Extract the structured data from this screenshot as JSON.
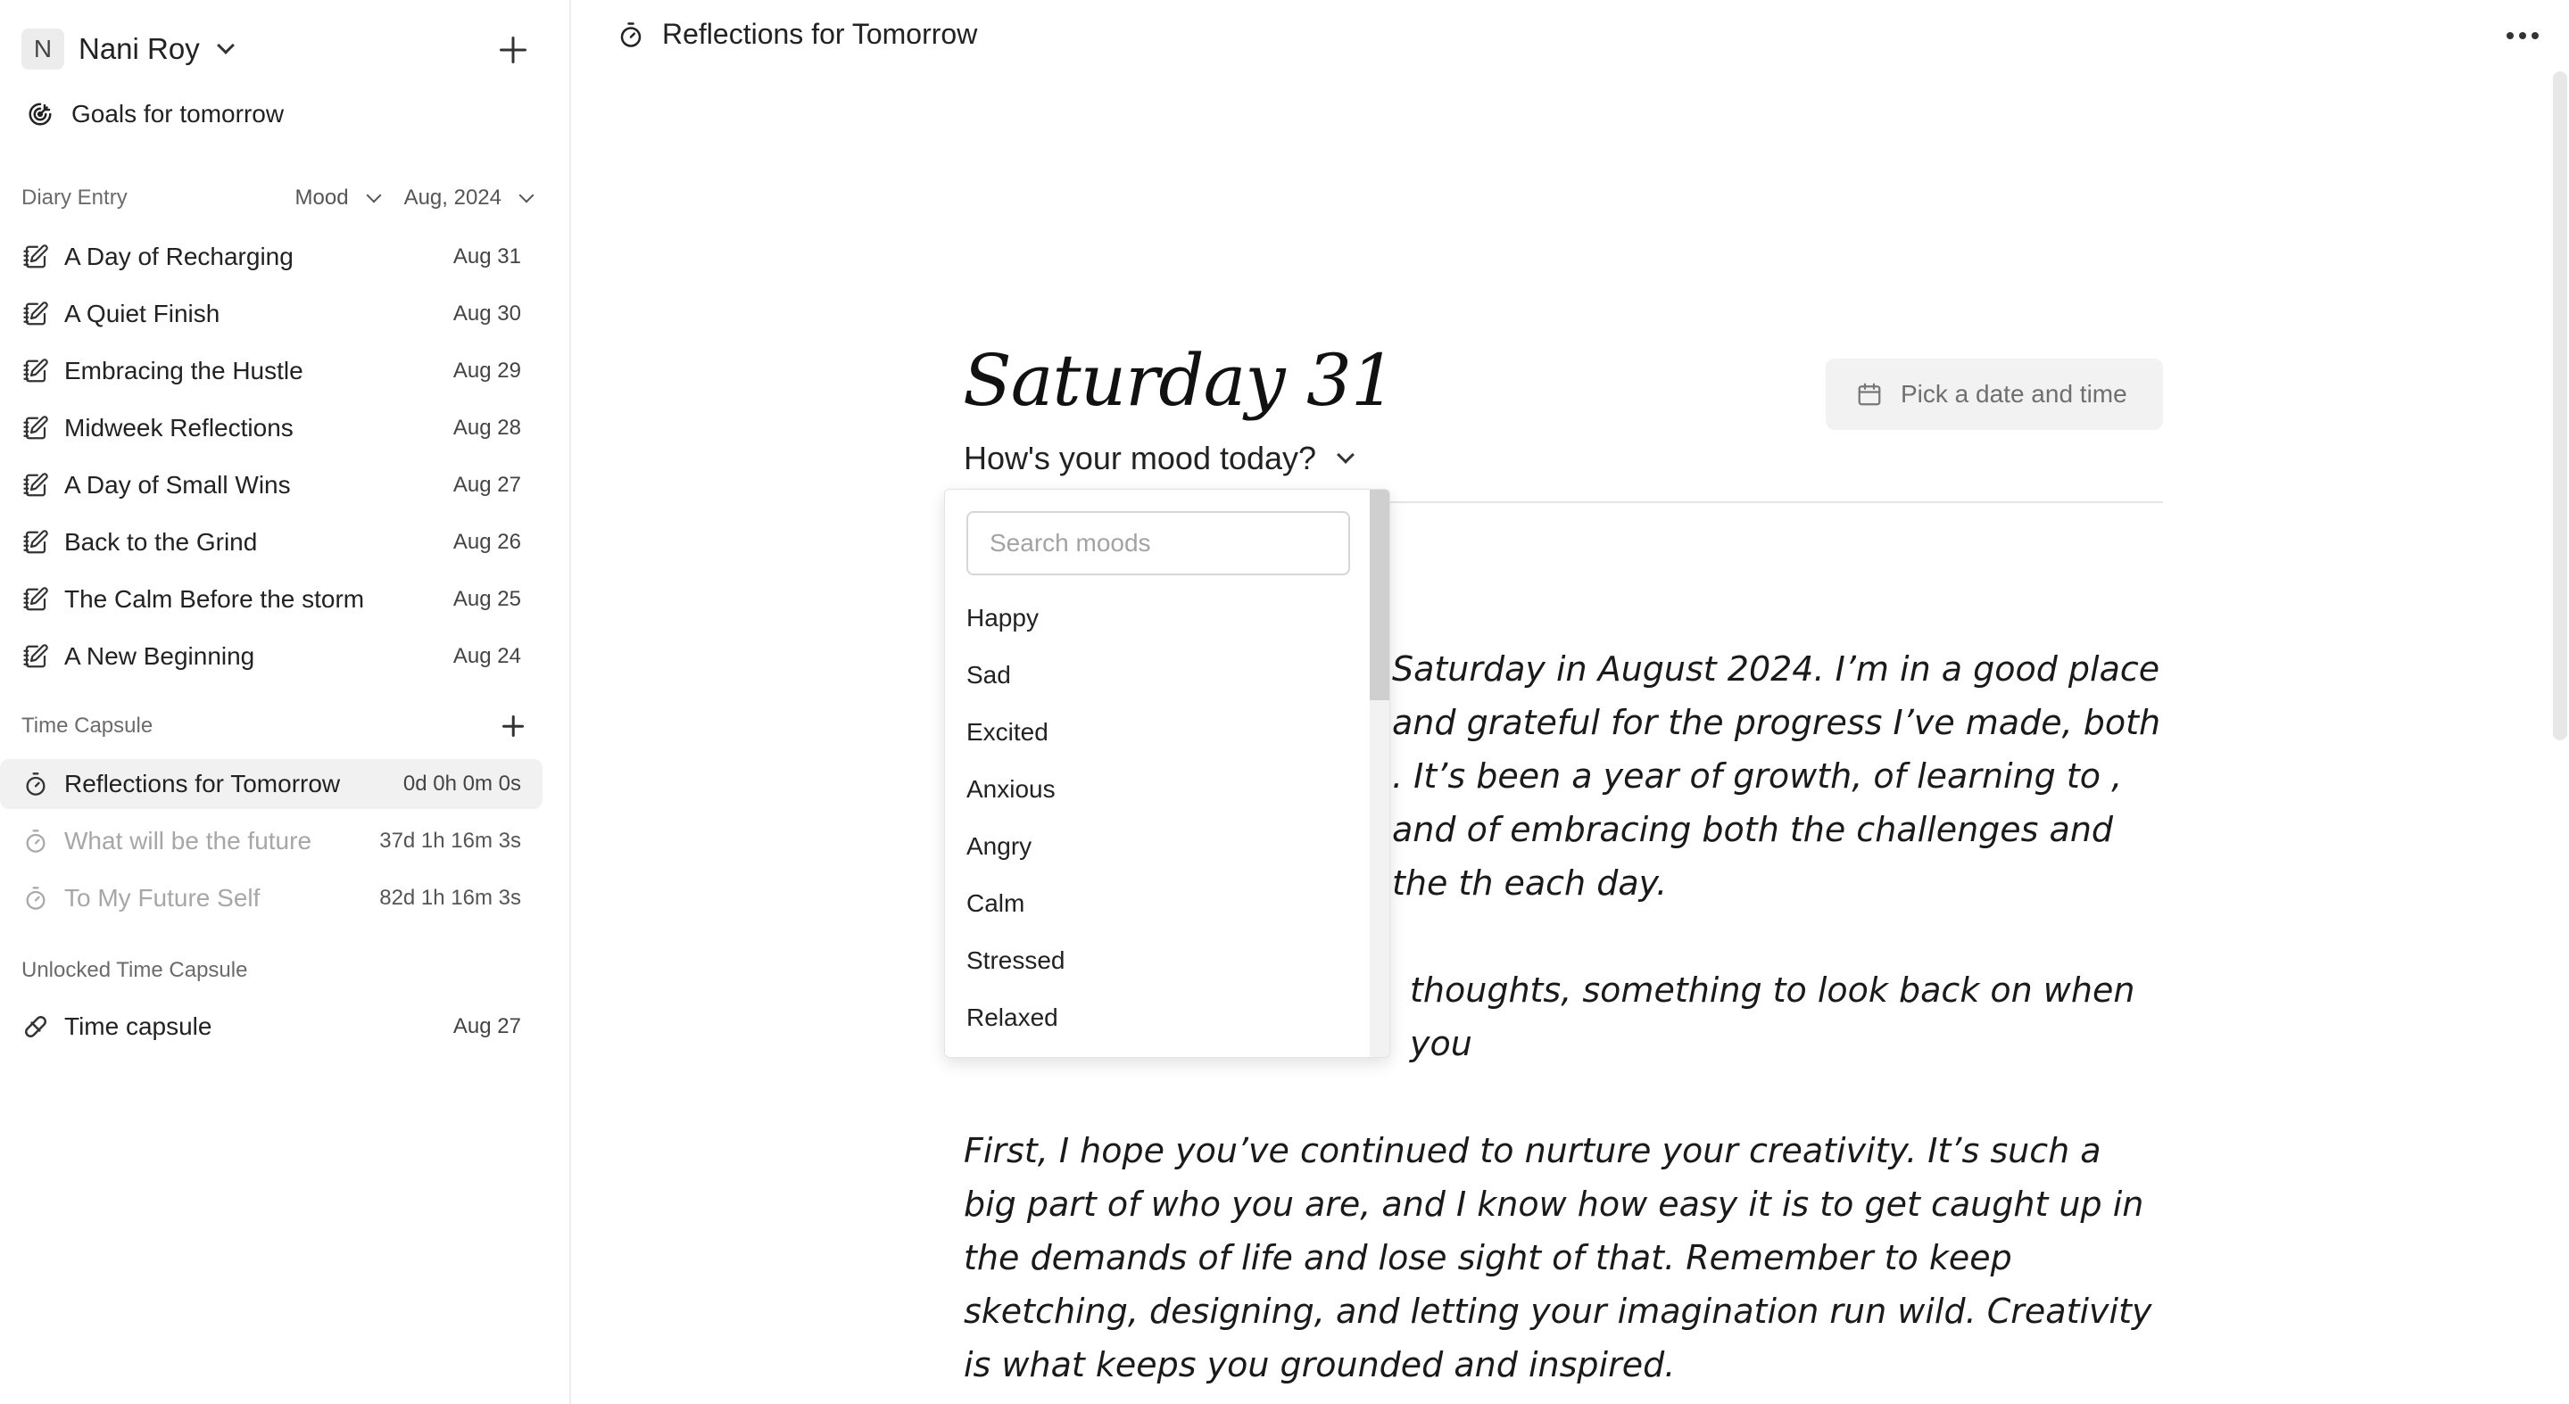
{
  "sidebar": {
    "user": {
      "initial": "N",
      "name": "Nani Roy"
    },
    "goals_label": "Goals for tomorrow",
    "diary": {
      "title": "Diary Entry",
      "mood_filter": "Mood",
      "date_filter": "Aug, 2024",
      "entries": [
        {
          "title": "A Day of Recharging",
          "date": "Aug 31"
        },
        {
          "title": "A Quiet Finish",
          "date": "Aug 30"
        },
        {
          "title": "Embracing the Hustle",
          "date": "Aug 29"
        },
        {
          "title": "Midweek Reflections",
          "date": "Aug 28"
        },
        {
          "title": "A Day of Small Wins",
          "date": "Aug 27"
        },
        {
          "title": "Back to the Grind",
          "date": "Aug 26"
        },
        {
          "title": "The Calm Before the storm",
          "date": "Aug 25"
        },
        {
          "title": "A New Beginning",
          "date": "Aug 24"
        }
      ]
    },
    "time_capsule": {
      "title": "Time Capsule",
      "items": [
        {
          "title": "Reflections for Tomorrow",
          "countdown": "0d 0h 0m 0s"
        },
        {
          "title": "What will be the future",
          "countdown": "37d 1h 16m 3s"
        },
        {
          "title": "To My Future Self",
          "countdown": "82d 1h 16m 3s"
        }
      ]
    },
    "unlocked": {
      "title": "Unlocked Time Capsule",
      "items": [
        {
          "title": "Time capsule",
          "date": "Aug 27"
        }
      ]
    }
  },
  "main": {
    "page_title": "Reflections for Tomorrow",
    "date_heading": "Saturday 31",
    "pick_date_label": "Pick a date and time",
    "mood_prompt": "How's your mood today?",
    "paragraphs": [
      "Saturday in August 2024. I’m in a good place and grateful for the progress I’ve made, both . It’s been a year of growth, of learning to , and of embracing both the challenges and the th each day.",
      "thoughts, something to look back on when you",
      "First, I hope you’ve continued to nurture your creativity. It’s such a big part of who you are, and I know how easy it is to get caught up in the demands of life and lose sight of that. Remember to keep sketching, designing, and letting your imagination run wild. Creativity is what keeps you grounded and inspired."
    ]
  },
  "mood_dropdown": {
    "search_placeholder": "Search moods",
    "search_value": "",
    "options": [
      "Happy",
      "Sad",
      "Excited",
      "Anxious",
      "Angry",
      "Calm",
      "Stressed",
      "Relaxed"
    ]
  }
}
